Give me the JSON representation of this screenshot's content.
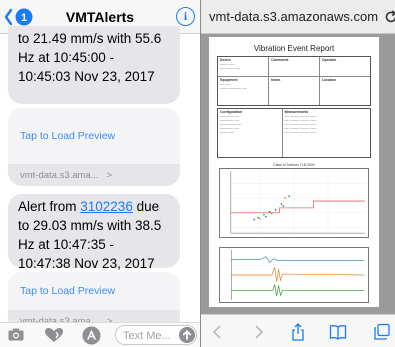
{
  "messages_app": {
    "title": "VMTAlerts",
    "info_glyph": "i",
    "bubble_1_lines": [
      "to 21.49 mm/s with 55.6",
      "Hz at 10:45:00 -",
      "10:45:03 Nov 23, 2017"
    ],
    "preview_1": {
      "link": "Tap to Load Preview",
      "domain": "vmt-data.s3.ama...",
      "chevron": ">"
    },
    "bubble_2": {
      "prefix": "Alert from ",
      "link": "3102236",
      "suffix": " due",
      "lines": [
        "to 29.03 mm/s with 38.5",
        "Hz at 10:47:35 -",
        "10:47:38 Nov 23, 2017"
      ]
    },
    "preview_2": {
      "link": "Tap to Load Preview",
      "domain": "vmt-data.s3.ama...",
      "chevron": ">"
    },
    "compose_placeholder": "Text Me...",
    "icons": [
      "back-icon",
      "info-icon",
      "camera-icon",
      "heart-icon",
      "app-store-icon",
      "send-icon"
    ]
  },
  "safari": {
    "url": "vmt-data.s3.amazonaws.com",
    "report_title": "Vibration Event Report",
    "tiny_labels": {
      "device": "Device",
      "comments": "Comments",
      "operator": "Operator",
      "equipment": "Equipment",
      "notes": "Notes",
      "location": "Location",
      "configuration": "Configuration",
      "measurements": "Measurements",
      "chart_title": "Class of Tremors TLD 0000"
    },
    "toolbar_icons": [
      "back-arrow-icon",
      "forward-arrow-icon",
      "share-icon",
      "bookmarks-icon",
      "tabs-icon"
    ],
    "colors": {
      "accent": "#1a7cf5",
      "bubble": "#e5e5ea",
      "threshold": "#e06666",
      "trace_orange": "#e67e22",
      "trace_green": "#2ca02c"
    }
  }
}
